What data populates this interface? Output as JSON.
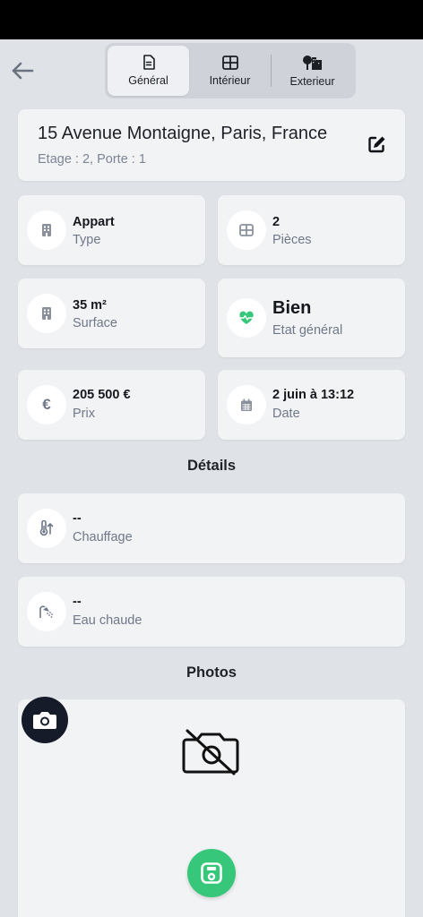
{
  "tabs": [
    {
      "label": "Général",
      "icon": "document-icon",
      "active": true
    },
    {
      "label": "Intérieur",
      "icon": "grid-icon",
      "active": false
    },
    {
      "label": "Exterieur",
      "icon": "trees-buildings-icon",
      "active": false
    }
  ],
  "address": {
    "title": "15 Avenue Montaigne, Paris, France",
    "subtitle": "Etage : 2, Porte : 1"
  },
  "info": {
    "type": {
      "value": "Appart",
      "label": "Type"
    },
    "rooms": {
      "value": "2",
      "label": "Pièces"
    },
    "surface": {
      "value": "35 m²",
      "label": "Surface"
    },
    "condition": {
      "value": "Bien",
      "label": "Etat général"
    },
    "price": {
      "value": "205 500 €",
      "label": "Prix"
    },
    "date": {
      "value": "2 juin à 13:12",
      "label": "Date"
    }
  },
  "details": {
    "title": "Détails",
    "heating": {
      "value": "--",
      "label": "Chauffage"
    },
    "hot_water": {
      "value": "--",
      "label": "Eau chaude"
    }
  },
  "photos": {
    "title": "Photos"
  },
  "colors": {
    "accent_green": "#37c77b",
    "dark_button": "#151b28",
    "background": "#dfe2e7",
    "card": "#f2f3f5"
  }
}
